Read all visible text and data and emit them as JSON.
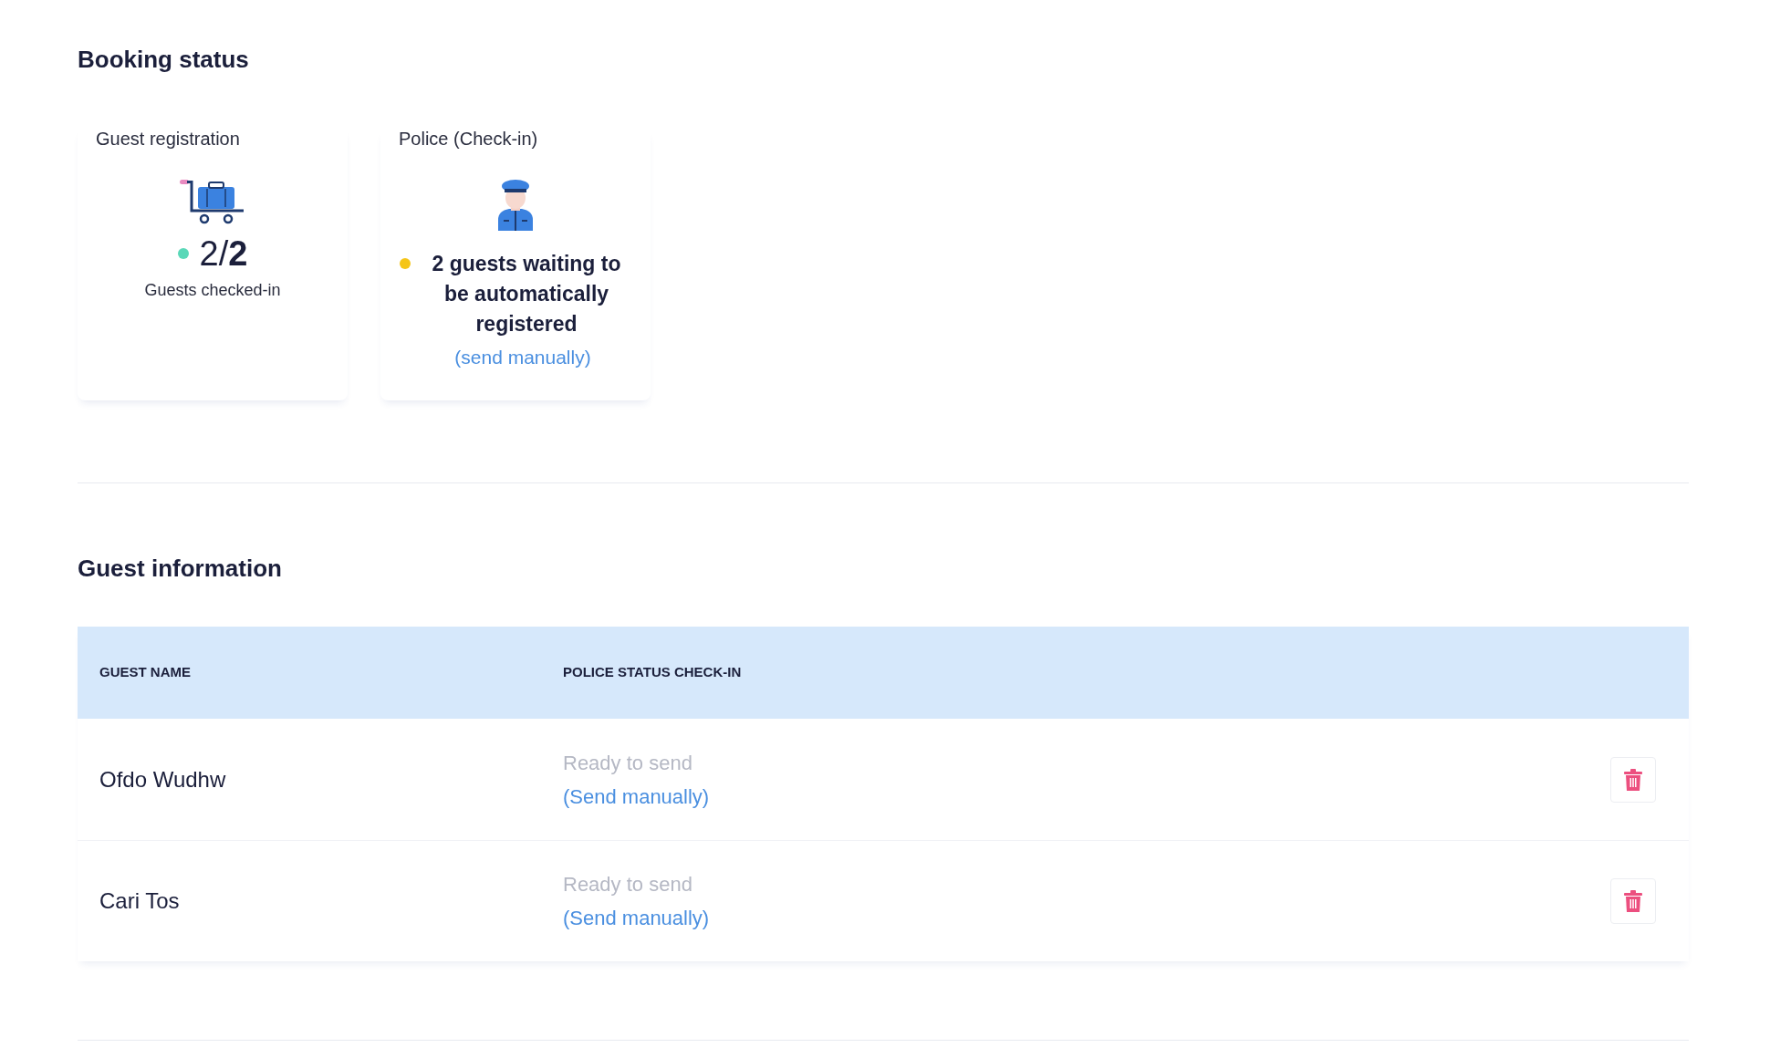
{
  "booking_status": {
    "title": "Booking status",
    "cards": [
      {
        "kind": "count",
        "title": "Guest registration",
        "color": "#5ad8b8",
        "value": "2/**2**",
        "caption": "Guests checked-in"
      },
      {
        "kind": "message",
        "title": "Police (Check-in)",
        "color": "#f5c518",
        "message": "2 guests waiting to be automatically registered",
        "link": "(send manually)"
      }
    ]
  },
  "guest_information": {
    "title": "Guest information",
    "table": {
      "columns": [
        "GUEST NAME",
        "POLICE STATUS CHECK-IN"
      ],
      "rows": [
        {
          "name": "Ofdo Wudhw",
          "status": "Ready to send",
          "link": "(Send manually)"
        },
        {
          "name": "Cari Tos",
          "status": "Ready to send",
          "link": "(Send manually)"
        }
      ]
    }
  }
}
